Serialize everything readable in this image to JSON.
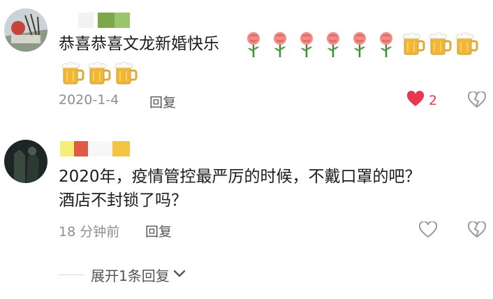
{
  "comments": [
    {
      "text": "恭喜恭喜文龙新婚快乐",
      "date": "2020-1-4",
      "reply_label": "回复",
      "like_count": "2",
      "liked": true,
      "emoji_rose_count": 6,
      "emoji_beer_count": 6
    },
    {
      "text_line1": "2020年，疫情管控最严厉的时候，不戴口罩的吧？",
      "text_line2": "酒店不封锁了吗？",
      "date": "18 分钟前",
      "reply_label": "回复",
      "liked": false
    }
  ],
  "expand_label": "展开1条回复",
  "colors": {
    "like_active": "#e8374e",
    "meta_text": "#8e8e8e",
    "censor_green": "#7aa84a",
    "censor_red": "#e05a45",
    "censor_yellow": "#f5c542"
  },
  "icons": [
    "heart-icon",
    "broken-heart-icon",
    "rose-emoji",
    "beer-emoji",
    "chevron-down-icon"
  ]
}
